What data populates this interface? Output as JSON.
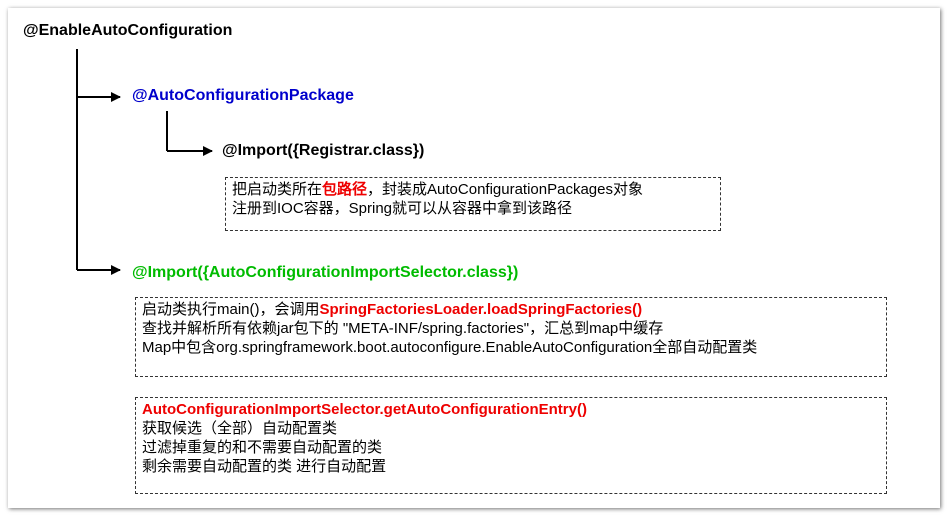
{
  "root": {
    "label": "@EnableAutoConfiguration"
  },
  "branch1": {
    "label": "@AutoConfigurationPackage",
    "child": {
      "label": "@Import({Registrar.class})",
      "note": {
        "line1_pre": "把启动类所在",
        "line1_highlight": "包路径",
        "line1_post": "，封装成AutoConfigurationPackages对象",
        "line2": "注册到IOC容器，Spring就可以从容器中拿到该路径"
      }
    }
  },
  "branch2": {
    "label": "@Import({AutoConfigurationImportSelector.class})",
    "note1": {
      "line1_pre": "启动类执行main()，会调用",
      "line1_highlight": "SpringFactoriesLoader.loadSpringFactories()",
      "line2": "查找并解析所有依赖jar包下的 \"META-INF/spring.factories\"，汇总到map中缓存",
      "line3": "Map中包含org.springframework.boot.autoconfigure.EnableAutoConfiguration全部自动配置类"
    },
    "note2": {
      "line1_highlight": "AutoConfigurationImportSelector.getAutoConfigurationEntry()",
      "line2": "获取候选（全部）自动配置类",
      "line3": "过滤掉重复的和不需要自动配置的类",
      "line4": "剩余需要自动配置的类 进行自动配置"
    }
  },
  "colors": {
    "root": "#000000",
    "branch1": "#0000cc",
    "branch2": "#00bb00",
    "highlight": "#ee0000"
  }
}
